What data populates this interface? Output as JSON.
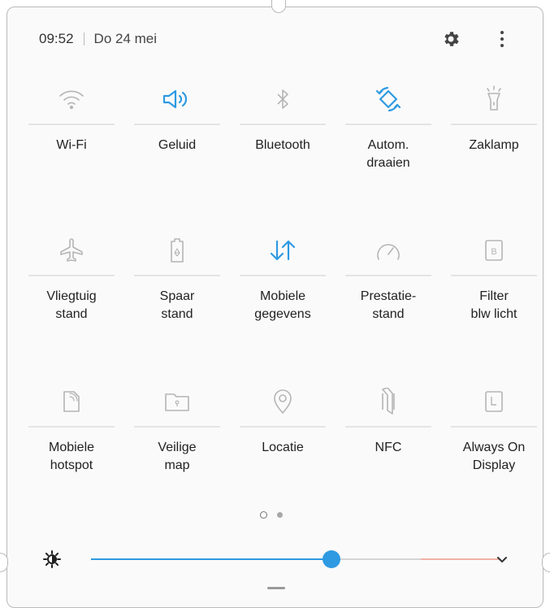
{
  "status": {
    "time": "09:52",
    "date": "Do 24 mei"
  },
  "header_icons": {
    "settings": "gear-icon",
    "more": "more-vertical-icon"
  },
  "tiles": [
    {
      "label": "Wi-Fi",
      "icon": "wifi-icon",
      "active": false
    },
    {
      "label": "Geluid",
      "icon": "sound-icon",
      "active": true
    },
    {
      "label": "Bluetooth",
      "icon": "bluetooth-icon",
      "active": false
    },
    {
      "label": "Autom.\ndraaien",
      "icon": "auto-rotate-icon",
      "active": true
    },
    {
      "label": "Zaklamp",
      "icon": "flashlight-icon",
      "active": false
    },
    {
      "label": "Vliegtuig\nstand",
      "icon": "airplane-icon",
      "active": false
    },
    {
      "label": "Spaar\nstand",
      "icon": "battery-saver-icon",
      "active": false
    },
    {
      "label": "Mobiele\ngegevens",
      "icon": "mobile-data-icon",
      "active": true
    },
    {
      "label": "Prestatie-\nstand",
      "icon": "performance-icon",
      "active": false
    },
    {
      "label": "Filter\nblw licht",
      "icon": "blue-light-filter-icon",
      "active": false
    },
    {
      "label": "Mobiele\nhotspot",
      "icon": "hotspot-icon",
      "active": false
    },
    {
      "label": "Veilige\nmap",
      "icon": "secure-folder-icon",
      "active": false
    },
    {
      "label": "Locatie",
      "icon": "location-icon",
      "active": false
    },
    {
      "label": "NFC",
      "icon": "nfc-icon",
      "active": false
    },
    {
      "label": "Always On\nDisplay",
      "icon": "always-on-display-icon",
      "active": false
    }
  ],
  "pager": {
    "pages": 2,
    "current": 1
  },
  "brightness": {
    "level": 0.59,
    "icon": "brightness-icon"
  },
  "colors": {
    "accent": "#2e9ae2",
    "inactive_icon": "#b5b5b5",
    "warm": "#f0b2a5"
  }
}
